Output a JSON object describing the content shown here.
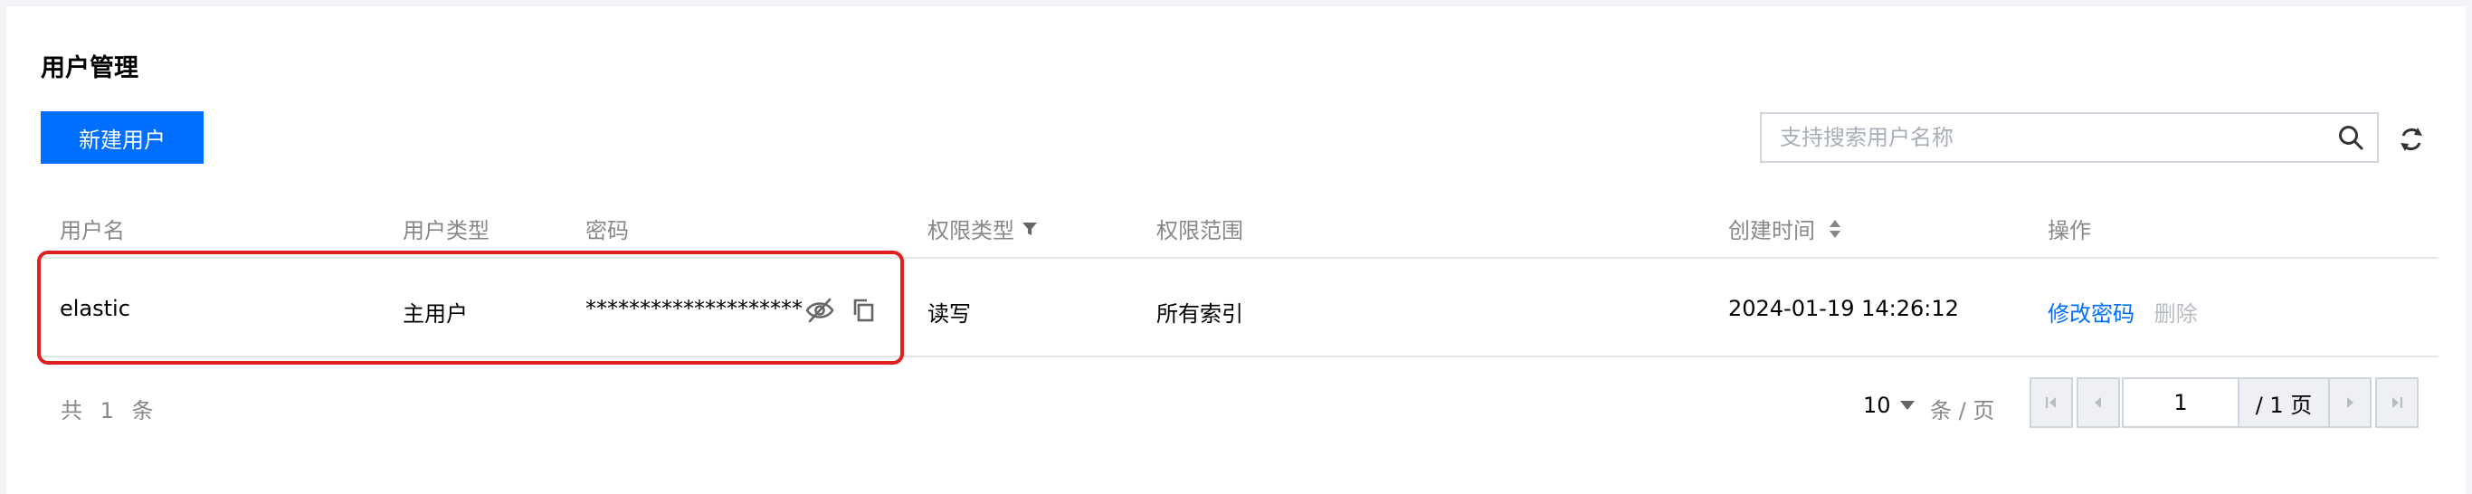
{
  "page": {
    "title": "用户管理"
  },
  "toolbar": {
    "create_label": "新建用户"
  },
  "search": {
    "placeholder": "支持搜索用户名称",
    "value": ""
  },
  "table": {
    "headers": {
      "username": "用户名",
      "user_type": "用户类型",
      "password": "密码",
      "permission_type": "权限类型",
      "permission_scope": "权限范围",
      "created_at": "创建时间",
      "actions": "操作"
    },
    "rows": [
      {
        "username": "elastic",
        "user_type": "主用户",
        "password": "********************",
        "permission_type": "读写",
        "permission_scope": "所有索引",
        "created_at": "2024-01-19 14:26:12",
        "action_edit": "修改密码",
        "action_delete": "删除"
      }
    ]
  },
  "footer": {
    "total_text": "共 1 条",
    "page_size": "10",
    "per_page_label": "条 / 页",
    "current_page": "1",
    "total_pages_label": "/ 1 页"
  },
  "colors": {
    "primary": "#006eff",
    "highlight": "#e02020",
    "muted_text": "#888888",
    "disabled_text": "#b8bcc2"
  }
}
